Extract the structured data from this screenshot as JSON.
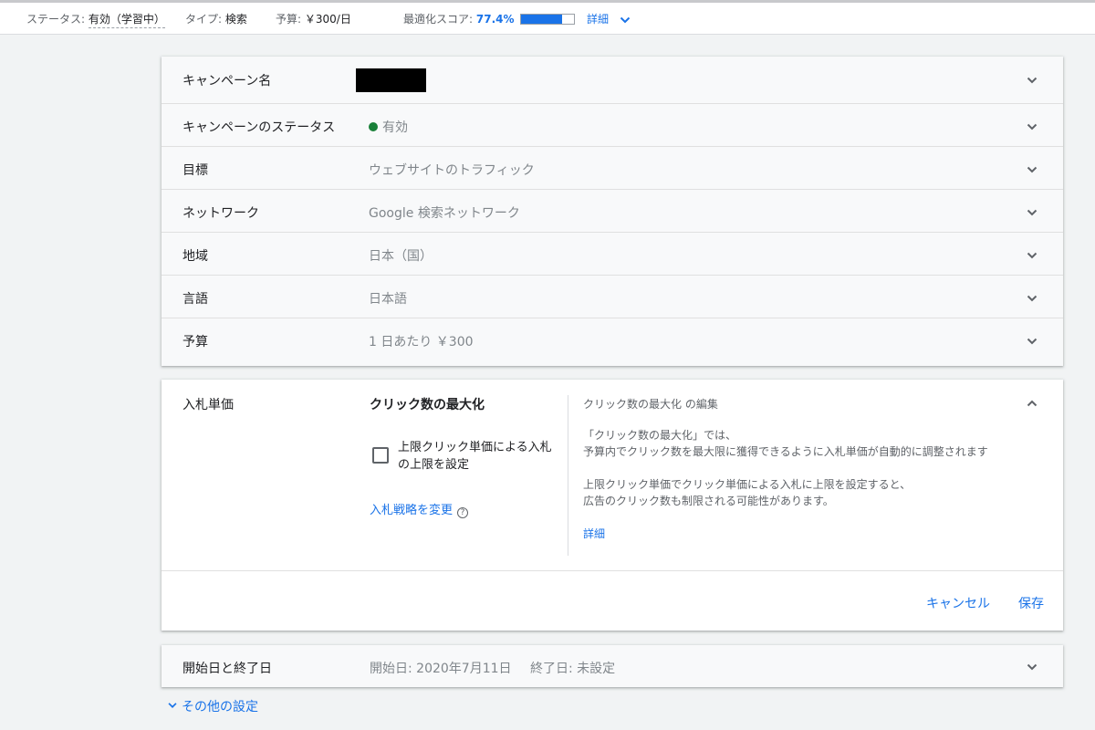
{
  "topbar": {
    "status_label": "ステータス:",
    "status_value": "有効（学習中）",
    "type_label": "タイプ:",
    "type_value": "検索",
    "budget_label": "予算:",
    "budget_value": "￥300/日",
    "score_label": "最適化スコア:",
    "score_value": "77.4%",
    "score_fraction": 0.774,
    "details_label": "詳細"
  },
  "settings": {
    "rows": [
      {
        "label": "キャンペーン名",
        "value": ""
      },
      {
        "label": "キャンペーンのステータス",
        "value": "有効"
      },
      {
        "label": "目標",
        "value": "ウェブサイトのトラフィック"
      },
      {
        "label": "ネットワーク",
        "value": "Google 検索ネットワーク"
      },
      {
        "label": "地域",
        "value": "日本（国）"
      },
      {
        "label": "言語",
        "value": "日本語"
      },
      {
        "label": "予算",
        "value": "1 日あたり ￥300"
      }
    ]
  },
  "bidding": {
    "title": "入札単価",
    "strategy": "クリック数の最大化",
    "checkbox_label": "上限クリック単価による入札の上限を設定",
    "checkbox_checked": false,
    "change_link": "入札戦略を変更",
    "help_title": "クリック数の最大化 の編集",
    "help_p1_line1": "「クリック数の最大化」では、",
    "help_p1_line2": "予算内でクリック数を最大限に獲得できるように入札単価が自動的に調整されます",
    "help_p2_line1": "上限クリック単価でクリック単価による入札に上限を設定すると、",
    "help_p2_line2": "広告のクリック数も制限される可能性があります。",
    "help_link": "詳細",
    "cancel": "キャンセル",
    "save": "保存"
  },
  "dates": {
    "label": "開始日と終了日",
    "start": "開始日: 2020年7月11日",
    "end": "終了日: 未設定"
  },
  "other_settings": "その他の設定",
  "colors": {
    "accent": "#1a73e8",
    "status_green": "#188038",
    "background": "#f1f3f4"
  }
}
